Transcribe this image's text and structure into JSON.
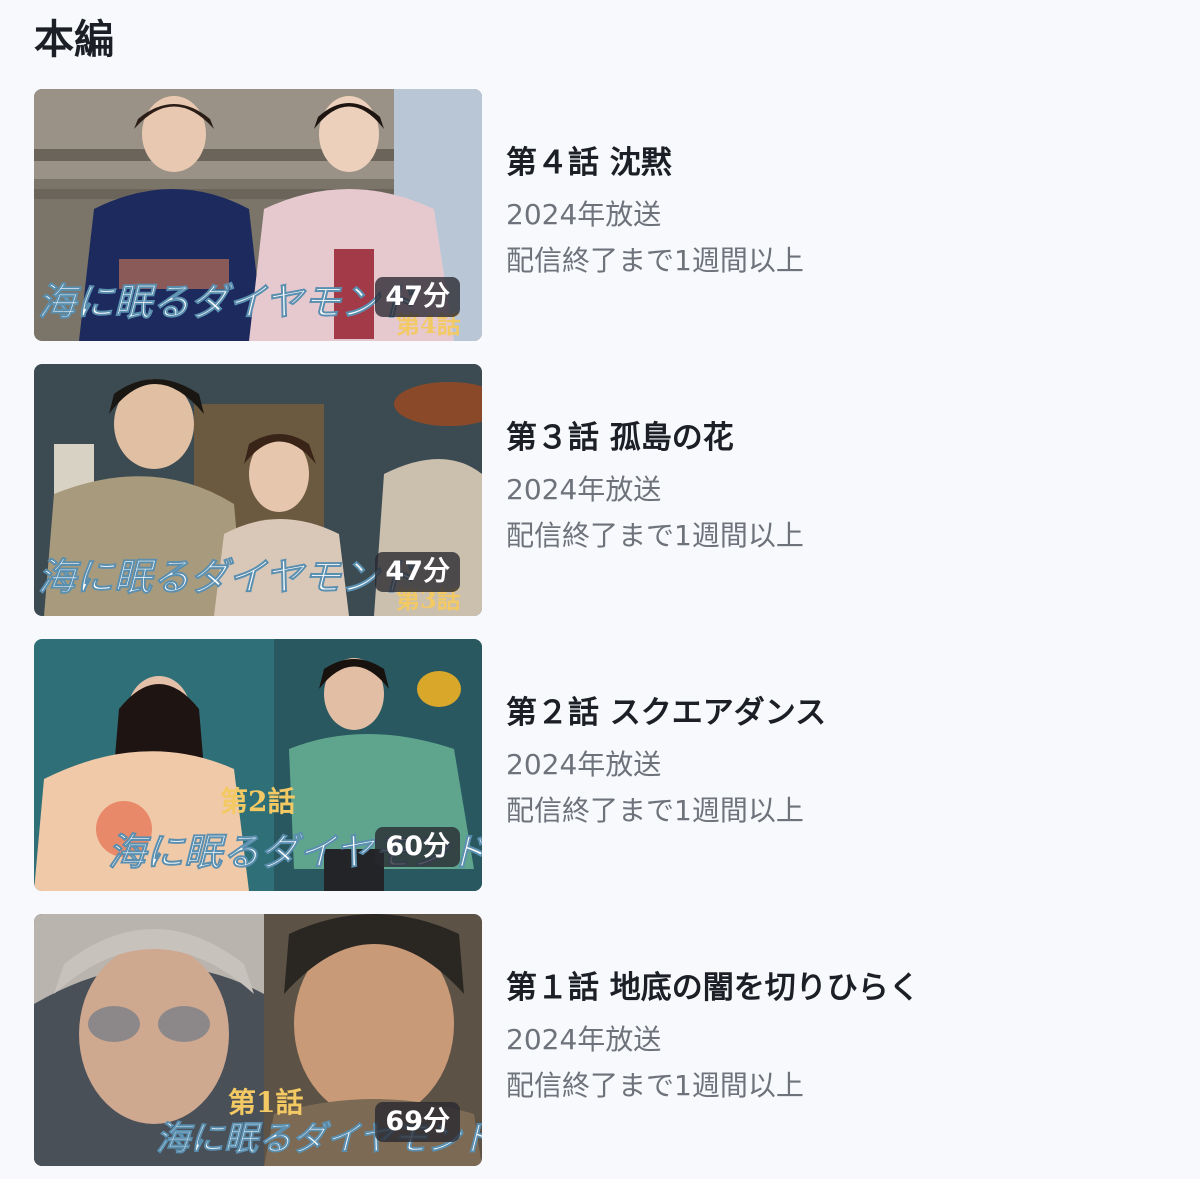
{
  "section": {
    "title": "本編"
  },
  "episodes": [
    {
      "title": "第４話 沈黙",
      "year": "2024年放送",
      "availability": "配信終了まで1週間以上",
      "duration": "47分",
      "thumb_logo": "海に眠るダイヤモンド",
      "thumb_badge": "第4話",
      "palette": {
        "bg": "#7b7468",
        "accent": "#1c2a5e",
        "accent2": "#e6c9cf"
      }
    },
    {
      "title": "第３話 孤島の花",
      "year": "2024年放送",
      "availability": "配信終了まで1週間以上",
      "duration": "47分",
      "thumb_logo": "海に眠るダイヤモンド",
      "thumb_badge": "第3話",
      "palette": {
        "bg": "#3c4a52",
        "accent": "#a89a7c",
        "accent2": "#d9c8b8"
      }
    },
    {
      "title": "第２話 スクエアダンス",
      "year": "2024年放送",
      "availability": "配信終了まで1週間以上",
      "duration": "60分",
      "thumb_logo": "海に眠るダイヤモンド",
      "thumb_badge": "第2話",
      "palette": {
        "bg": "#2f6f78",
        "accent": "#5fa58e",
        "accent2": "#f0c9a8"
      }
    },
    {
      "title": "第１話 地底の闇を切りひらく",
      "year": "2024年放送",
      "availability": "配信終了まで1週間以上",
      "duration": "69分",
      "thumb_logo": "海に眠るダイヤモンド",
      "thumb_badge": "第1話",
      "palette": {
        "bg": "#5c5246",
        "accent": "#b9b4ae",
        "accent2": "#2a2622"
      }
    }
  ]
}
